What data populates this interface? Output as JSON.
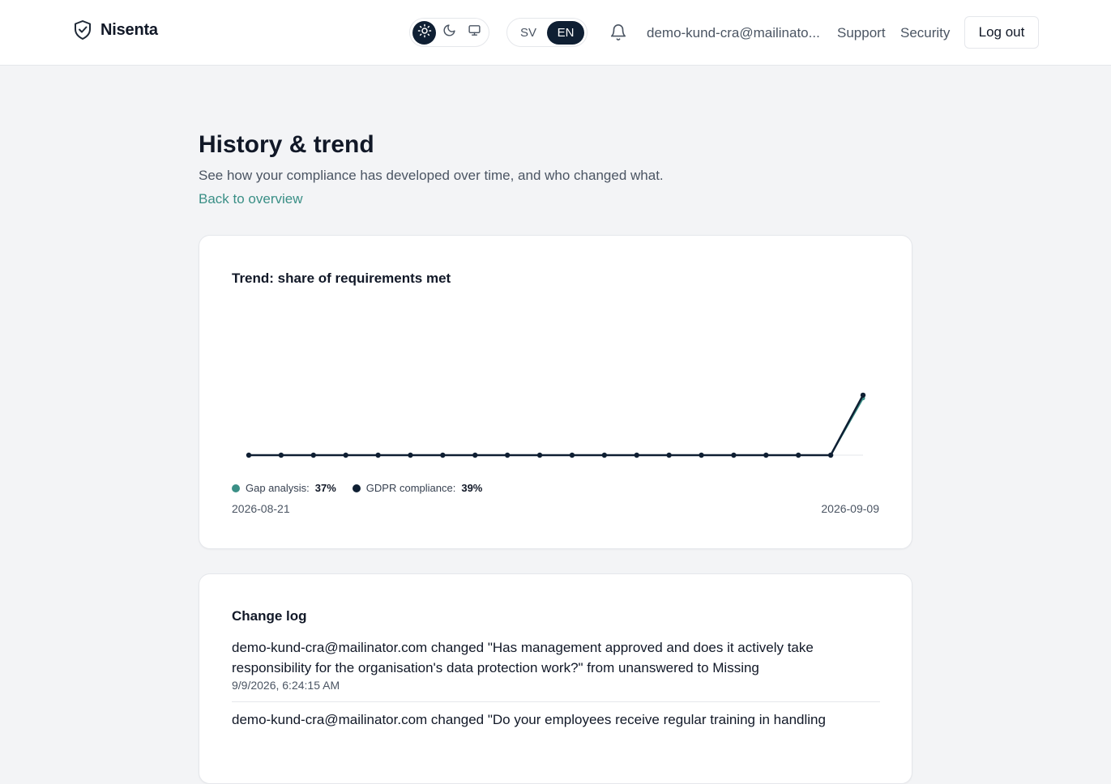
{
  "header": {
    "brand": "Nisenta",
    "theme_options": [
      {
        "icon": "sun-icon",
        "active": true
      },
      {
        "icon": "moon-icon",
        "active": false
      },
      {
        "icon": "monitor-icon",
        "active": false
      }
    ],
    "languages": [
      {
        "label": "SV",
        "active": false
      },
      {
        "label": "EN",
        "active": true
      }
    ],
    "notifications_icon": "bell-icon",
    "user_email": "demo-kund-cra@mailinato...",
    "support_label": "Support",
    "security_label": "Security",
    "logout_label": "Log out"
  },
  "page": {
    "title": "History & trend",
    "subtitle": "See how your compliance has developed over time, and who changed what.",
    "back_link": "Back to overview"
  },
  "trend": {
    "title": "Trend: share of requirements met",
    "start_date": "2026-08-21",
    "end_date": "2026-09-09",
    "legend": [
      {
        "name": "Gap analysis:",
        "value": "37%",
        "color": "#3a8f86"
      },
      {
        "name": "GDPR compliance:",
        "value": "39%",
        "color": "#0f1f33"
      }
    ]
  },
  "chart_data": {
    "type": "line",
    "x": [
      "2026-08-21",
      "2026-08-22",
      "2026-08-23",
      "2026-08-24",
      "2026-08-25",
      "2026-08-26",
      "2026-08-27",
      "2026-08-28",
      "2026-08-29",
      "2026-08-30",
      "2026-08-31",
      "2026-09-01",
      "2026-09-02",
      "2026-09-03",
      "2026-09-04",
      "2026-09-05",
      "2026-09-06",
      "2026-09-07",
      "2026-09-08",
      "2026-09-09"
    ],
    "series": [
      {
        "name": "Gap analysis",
        "color": "#3a8f86",
        "values": [
          0,
          0,
          0,
          0,
          0,
          0,
          0,
          0,
          0,
          0,
          0,
          0,
          0,
          0,
          0,
          0,
          0,
          0,
          0,
          37
        ]
      },
      {
        "name": "GDPR compliance",
        "color": "#0f1f33",
        "values": [
          0,
          0,
          0,
          0,
          0,
          0,
          0,
          0,
          0,
          0,
          0,
          0,
          0,
          0,
          0,
          0,
          0,
          0,
          0,
          39
        ]
      }
    ],
    "ylim": [
      0,
      100
    ],
    "grid": false
  },
  "changelog": {
    "title": "Change log",
    "entries": [
      {
        "text": "demo-kund-cra@mailinator.com changed \"Has management approved and does it actively take responsibility for the organisation's data protection work?\" from unanswered to Missing",
        "time": "9/9/2026, 6:24:15 AM"
      },
      {
        "text": "demo-kund-cra@mailinator.com changed \"Do your employees receive regular training in handling",
        "time": ""
      }
    ]
  }
}
